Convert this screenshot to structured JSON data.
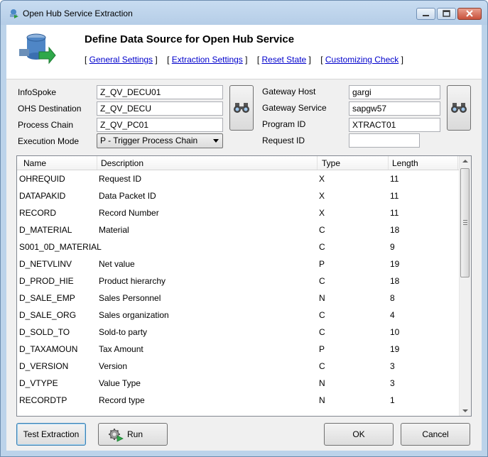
{
  "window": {
    "title": "Open Hub Service Extraction"
  },
  "header": {
    "title": "Define Data Source for Open Hub Service",
    "links": [
      {
        "label": "General Settings"
      },
      {
        "label": "Extraction Settings"
      },
      {
        "label": "Reset State"
      },
      {
        "label": "Customizing Check"
      }
    ]
  },
  "form": {
    "infospoke_label": "InfoSpoke",
    "infospoke_value": "Z_QV_DECU01",
    "ohs_destination_label": "OHS Destination",
    "ohs_destination_value": "Z_QV_DECU",
    "process_chain_label": "Process Chain",
    "process_chain_value": "Z_QV_PC01",
    "execution_mode_label": "Execution Mode",
    "execution_mode_value": "P - Trigger Process Chain",
    "gateway_host_label": "Gateway Host",
    "gateway_host_value": "gargi",
    "gateway_service_label": "Gateway Service",
    "gateway_service_value": "sapgw57",
    "program_id_label": "Program ID",
    "program_id_value": "XTRACT01",
    "request_id_label": "Request ID",
    "request_id_value": ""
  },
  "grid": {
    "columns": [
      "Name",
      "Description",
      "Type",
      "Length"
    ],
    "rows": [
      {
        "name": "OHREQUID",
        "description": "Request ID",
        "type": "X",
        "length": "11"
      },
      {
        "name": "DATAPAKID",
        "description": "Data Packet ID",
        "type": "X",
        "length": "11"
      },
      {
        "name": "RECORD",
        "description": "Record Number",
        "type": "X",
        "length": "11"
      },
      {
        "name": "D_MATERIAL",
        "description": "Material",
        "type": "C",
        "length": "18"
      },
      {
        "name": "S001_0D_MATERIAL",
        "description": "",
        "type": "C",
        "length": "9"
      },
      {
        "name": "D_NETVLINV",
        "description": "Net value",
        "type": "P",
        "length": "19"
      },
      {
        "name": "D_PROD_HIE",
        "description": "Product hierarchy",
        "type": "C",
        "length": "18"
      },
      {
        "name": "D_SALE_EMP",
        "description": "Sales Personnel",
        "type": "N",
        "length": "8"
      },
      {
        "name": "D_SALE_ORG",
        "description": "Sales organization",
        "type": "C",
        "length": "4"
      },
      {
        "name": "D_SOLD_TO",
        "description": "Sold-to party",
        "type": "C",
        "length": "10"
      },
      {
        "name": "D_TAXAMOUN",
        "description": "Tax Amount",
        "type": "P",
        "length": "19"
      },
      {
        "name": "D_VERSION",
        "description": "Version",
        "type": "C",
        "length": "3"
      },
      {
        "name": "D_VTYPE",
        "description": "Value Type",
        "type": "N",
        "length": "3"
      },
      {
        "name": "RECORDTP",
        "description": "Record type",
        "type": "N",
        "length": "1"
      }
    ]
  },
  "buttons": {
    "test_extraction": "Test Extraction",
    "run": "Run",
    "ok": "OK",
    "cancel": "Cancel"
  }
}
